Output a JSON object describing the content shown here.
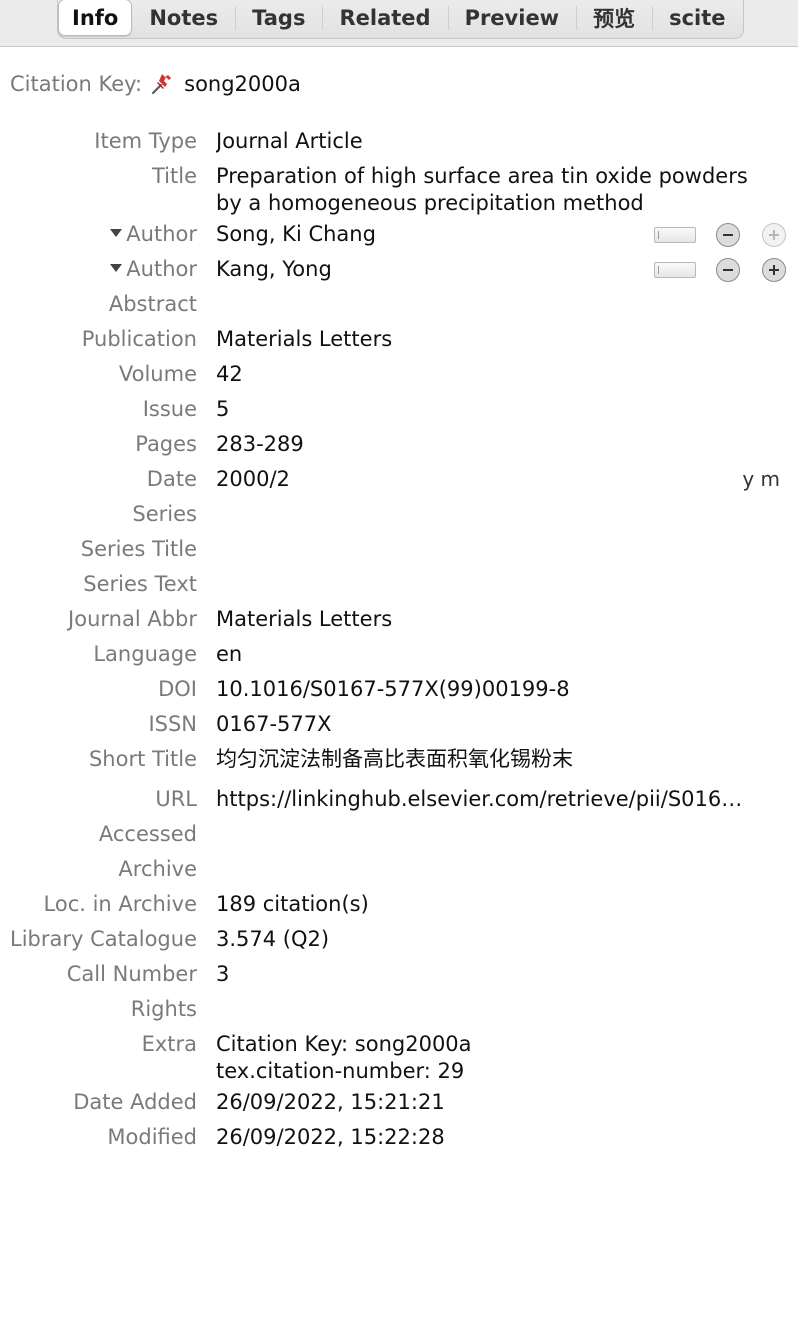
{
  "tabs": [
    {
      "label": "Info",
      "active": true
    },
    {
      "label": "Notes",
      "active": false
    },
    {
      "label": "Tags",
      "active": false
    },
    {
      "label": "Related",
      "active": false
    },
    {
      "label": "Preview",
      "active": false
    },
    {
      "label": "预览",
      "active": false
    },
    {
      "label": "scite",
      "active": false
    }
  ],
  "citation_key": {
    "label": "Citation Key:",
    "icon": "pushpin-icon",
    "value": "song2000a"
  },
  "fields": {
    "item_type": {
      "label": "Item Type",
      "value": "Journal Article"
    },
    "title": {
      "label": "Title",
      "value": "Preparation of high surface area tin oxide powders by a homogeneous precipitation method"
    },
    "authors": [
      {
        "label": "Author",
        "value": "Song, Ki Chang",
        "plus_enabled": false
      },
      {
        "label": "Author",
        "value": "Kang, Yong",
        "plus_enabled": true
      }
    ],
    "abstract": {
      "label": "Abstract",
      "value": ""
    },
    "publication": {
      "label": "Publication",
      "value": "Materials Letters"
    },
    "volume": {
      "label": "Volume",
      "value": "42"
    },
    "issue": {
      "label": "Issue",
      "value": "5"
    },
    "pages": {
      "label": "Pages",
      "value": "283-289"
    },
    "date": {
      "label": "Date",
      "value": "2000/2",
      "format_hint": "y m"
    },
    "series": {
      "label": "Series",
      "value": ""
    },
    "series_title": {
      "label": "Series Title",
      "value": ""
    },
    "series_text": {
      "label": "Series Text",
      "value": ""
    },
    "journal_abbr": {
      "label": "Journal Abbr",
      "value": "Materials Letters"
    },
    "language": {
      "label": "Language",
      "value": "en"
    },
    "doi": {
      "label": "DOI",
      "value": "10.1016/S0167-577X(99)00199-8"
    },
    "issn": {
      "label": "ISSN",
      "value": "0167-577X"
    },
    "short_title": {
      "label": "Short Title",
      "value": "均匀沉淀法制备高比表面积氧化锡粉末"
    },
    "url": {
      "label": "URL",
      "value": "https://linkinghub.elsevier.com/retrieve/pii/S016…"
    },
    "accessed": {
      "label": "Accessed",
      "value": ""
    },
    "archive": {
      "label": "Archive",
      "value": ""
    },
    "loc_in_archive": {
      "label": "Loc. in Archive",
      "value": "189 citation(s)"
    },
    "library_catalogue": {
      "label": "Library Catalogue",
      "value": "3.574 (Q2)"
    },
    "call_number": {
      "label": "Call Number",
      "value": "3"
    },
    "rights": {
      "label": "Rights",
      "value": ""
    },
    "extra": {
      "label": "Extra",
      "line1": "Citation Key: song2000a",
      "line2": "tex.citation-number: 29"
    },
    "date_added": {
      "label": "Date Added",
      "value": "26/09/2022, 15:21:21"
    },
    "modified": {
      "label": "Modified",
      "value": "26/09/2022, 15:22:28"
    }
  },
  "colors": {
    "label": "#7a7a7a",
    "value": "#111111",
    "pin": "#d0342c"
  }
}
